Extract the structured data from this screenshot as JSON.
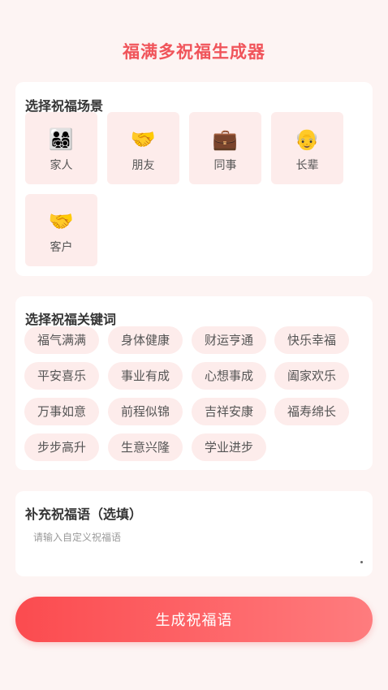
{
  "app": {
    "title": "福满多祝福生成器"
  },
  "scenes": {
    "title": "选择祝福场景",
    "items": [
      {
        "icon": "family-icon",
        "emoji": "👨‍👩‍👧‍👦",
        "label": "家人"
      },
      {
        "icon": "handshake-icon",
        "emoji": "🤝",
        "label": "朋友"
      },
      {
        "icon": "briefcase-icon",
        "emoji": "💼",
        "label": "同事"
      },
      {
        "icon": "older-person-icon",
        "emoji": "👴",
        "label": "长辈"
      },
      {
        "icon": "handshake-icon",
        "emoji": "🤝",
        "label": "客户"
      }
    ]
  },
  "keywords": {
    "title": "选择祝福关键词",
    "items": [
      "福气满满",
      "身体健康",
      "财运亨通",
      "快乐幸福",
      "平安喜乐",
      "事业有成",
      "心想事成",
      "阖家欢乐",
      "万事如意",
      "前程似锦",
      "吉祥安康",
      "福寿绵长",
      "步步高升",
      "生意兴隆",
      "学业进步"
    ]
  },
  "custom": {
    "title": "补充祝福语（选填）",
    "placeholder": "请输入自定义祝福语",
    "value": ""
  },
  "generate_button": {
    "label": "生成祝福语"
  },
  "colors": {
    "accent": "#f0545a",
    "chip_bg": "#fdeceb",
    "page_bg": "#fdf4f3",
    "button_gradient_start": "#fb4b4f",
    "button_gradient_end": "#fe7c7e"
  }
}
